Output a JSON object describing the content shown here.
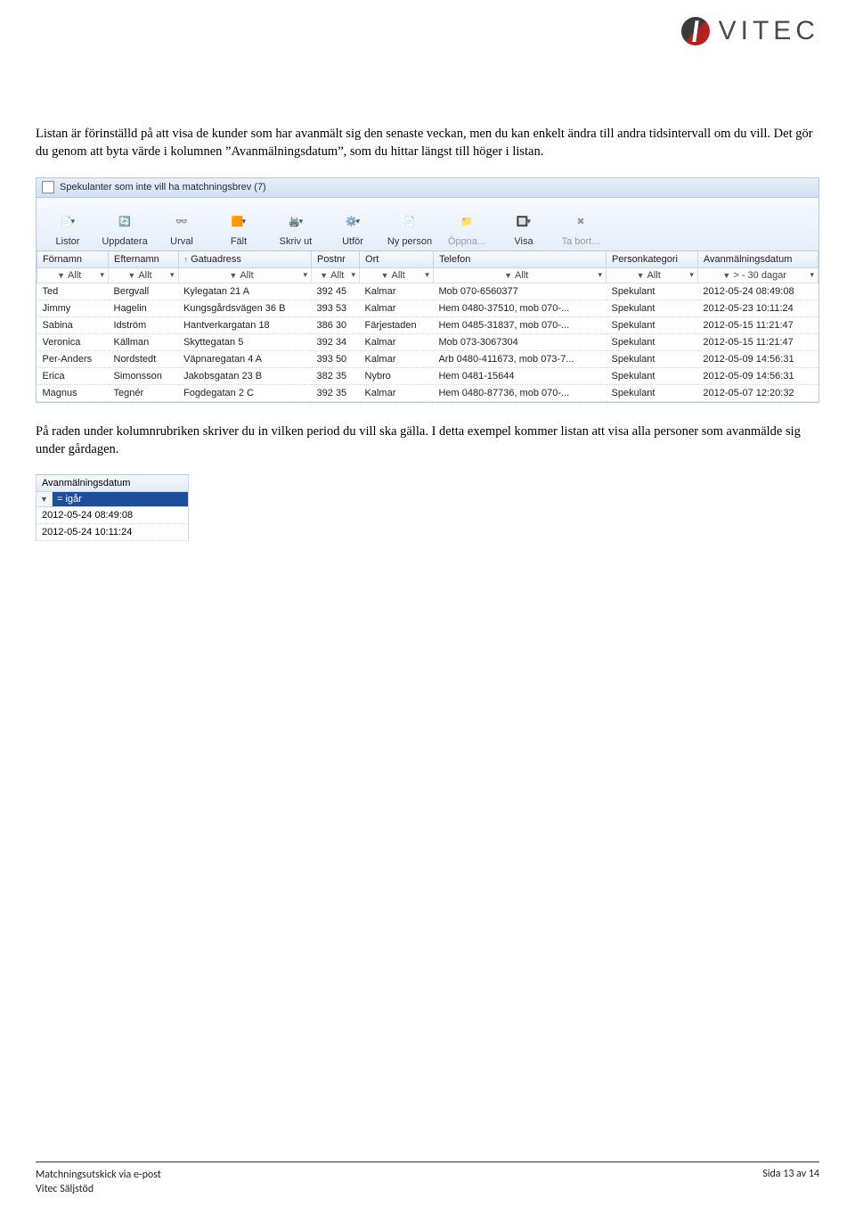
{
  "logo": {
    "text": "VITEC"
  },
  "para1": "Listan är förinställd på att visa de kunder som har avanmält sig den senaste veckan, men du kan enkelt ändra till andra tidsintervall om du vill. Det gör du genom att byta värde i kolumnen ”Avanmälningsdatum”, som du hittar längst till höger i listan.",
  "para2": "På raden under kolumnrubriken skriver du in vilken period du vill ska gälla. I detta exempel kommer listan att visa alla personer som avanmälde sig under gårdagen.",
  "app": {
    "title": "Spekulanter som inte vill ha matchningsbrev (7)",
    "toolbar": [
      {
        "label": "Listor",
        "drop": true
      },
      {
        "label": "Uppdatera"
      },
      {
        "label": "Urval"
      },
      {
        "label": "Fält",
        "drop": true
      },
      {
        "label": "Skriv ut",
        "drop": true
      },
      {
        "label": "Utför",
        "drop": true
      },
      {
        "label": "Ny person"
      },
      {
        "label": "Öppna...",
        "dim": true
      },
      {
        "label": "Visa",
        "drop": true
      },
      {
        "label": "Ta bort...",
        "dim": true
      }
    ],
    "columns": [
      "Förnamn",
      "Efternamn",
      "Gatuadress",
      "Postnr",
      "Ort",
      "Telefon",
      "Personkategori",
      "Avanmälningsdatum"
    ],
    "sort_col_index": 2,
    "filters": [
      "Allt",
      "Allt",
      "Allt",
      "Allt",
      "Allt",
      "Allt",
      "Allt",
      "> - 30 dagar"
    ],
    "rows": [
      {
        "fn": "Ted",
        "en": "Bergvall",
        "addr": "Kylegatan 21 A",
        "pn": "392 45",
        "ort": "Kalmar",
        "tel": "Mob 070-6560377",
        "kat": "Spekulant",
        "dat": "2012-05-24 08:49:08"
      },
      {
        "fn": "Jimmy",
        "en": "Hagelin",
        "addr": "Kungsgårdsvägen 36 B",
        "pn": "393 53",
        "ort": "Kalmar",
        "tel": "Hem 0480-37510, mob 070-...",
        "kat": "Spekulant",
        "dat": "2012-05-23 10:11:24"
      },
      {
        "fn": "Sabina",
        "en": "Idström",
        "addr": "Hantverkargatan 18",
        "pn": "386 30",
        "ort": "Färjestaden",
        "tel": "Hem 0485-31837, mob 070-...",
        "kat": "Spekulant",
        "dat": "2012-05-15 11:21:47"
      },
      {
        "fn": "Veronica",
        "en": "Källman",
        "addr": "Skyttegatan 5",
        "pn": "392 34",
        "ort": "Kalmar",
        "tel": "Mob 073-3067304",
        "kat": "Spekulant",
        "dat": "2012-05-15 11:21:47"
      },
      {
        "fn": "Per-Anders",
        "en": "Nordstedt",
        "addr": "Väpnaregatan 4 A",
        "pn": "393 50",
        "ort": "Kalmar",
        "tel": "Arb 0480-411673, mob 073-7...",
        "kat": "Spekulant",
        "dat": "2012-05-09 14:56:31"
      },
      {
        "fn": "Erica",
        "en": "Simonsson",
        "addr": "Jakobsgatan 23 B",
        "pn": "382 35",
        "ort": "Nybro",
        "tel": "Hem 0481-15644",
        "kat": "Spekulant",
        "dat": "2012-05-09 14:56:31"
      },
      {
        "fn": "Magnus",
        "en": "Tegnér",
        "addr": "Fogdegatan 2 C",
        "pn": "392 35",
        "ort": "Kalmar",
        "tel": "Hem 0480-87736, mob 070-...",
        "kat": "Spekulant",
        "dat": "2012-05-07 12:20:32"
      }
    ]
  },
  "mini": {
    "header": "Avanmälningsdatum",
    "filter": "= igår",
    "rows": [
      "2012-05-24 08:49:08",
      "2012-05-24 10:11:24"
    ]
  },
  "footer": {
    "left1": "Matchningsutskick via e-post",
    "left2": "Vitec Säljstöd",
    "right": "Sida 13 av 14"
  },
  "icons": {
    "listor": "📄",
    "uppdatera": "🔄",
    "urval": "👓",
    "falt": "🟧",
    "skrivut": "🖨️",
    "utfor": "⚙️",
    "nyperson": "📄",
    "oppna": "📁",
    "visa": "🔲",
    "tabort": "✖"
  }
}
